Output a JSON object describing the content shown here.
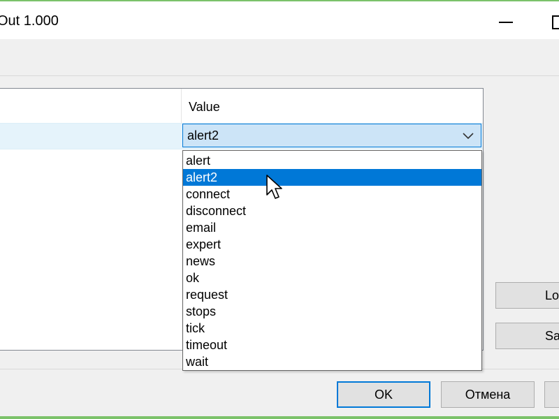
{
  "window": {
    "title": "Out 1.000"
  },
  "grid": {
    "value_header": "Value",
    "selected_value": "alert2"
  },
  "dropdown": {
    "items": [
      "alert",
      "alert2",
      "connect",
      "disconnect",
      "email",
      "expert",
      "news",
      "ok",
      "request",
      "stops",
      "tick",
      "timeout",
      "wait"
    ],
    "highlighted": "alert2"
  },
  "side_buttons": {
    "load_label": "Lo",
    "save_label": "Sa"
  },
  "footer": {
    "ok_label": "OK",
    "cancel_label": "Отмена"
  },
  "colors": {
    "accent": "#0078d7",
    "window_border": "#7bc26a",
    "selection_row": "#e5f3fb"
  }
}
